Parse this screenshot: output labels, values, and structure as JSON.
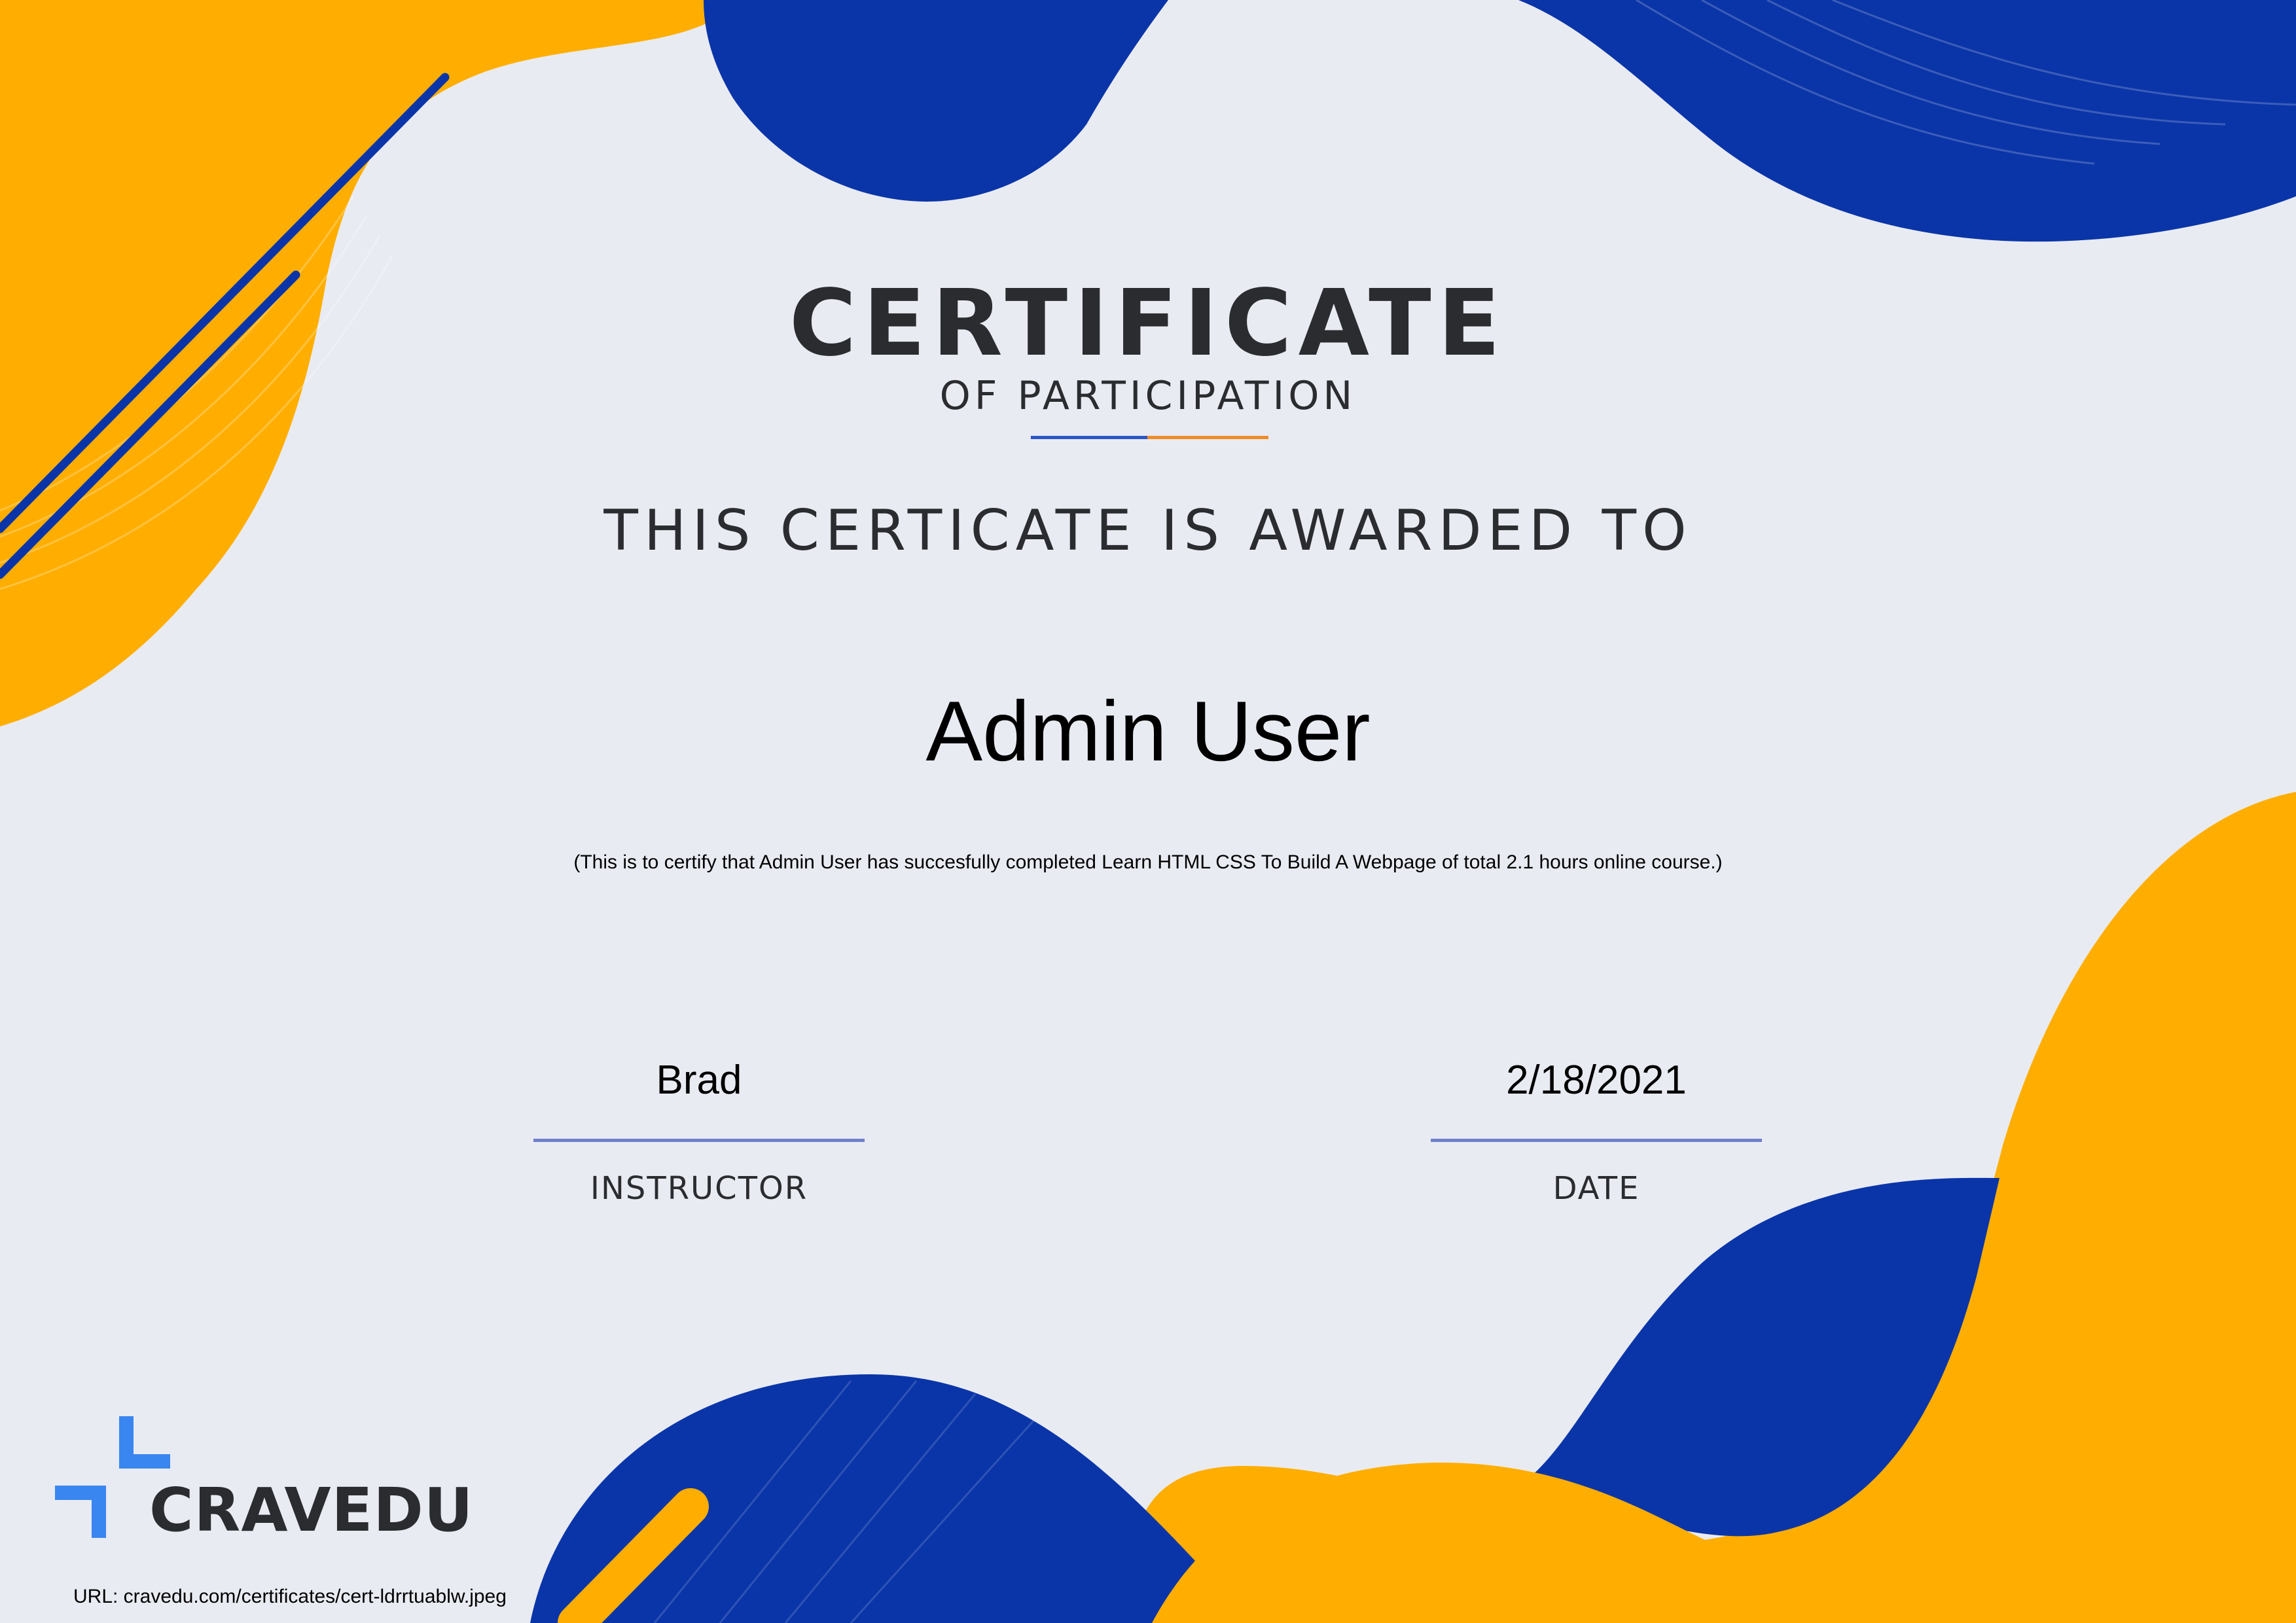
{
  "certificate": {
    "title": "CERTIFICATE",
    "subtitle": "OF PARTICIPATION",
    "awarded_text": "THIS CERTICATE IS AWARDED TO",
    "recipient_name": "Admin User",
    "statement": "(This is to certify that Admin User has succesfully completed Learn HTML CSS To Build A Webpage of total 2.1 hours online course.)"
  },
  "signatures": {
    "instructor": {
      "value": "Brad",
      "label": "INSTRUCTOR"
    },
    "date": {
      "value": "2/18/2021",
      "label": "DATE"
    }
  },
  "footer": {
    "brand_name": "CRAVEDU",
    "url_text": "URL: cravedu.com/certificates/cert-ldrrtuablw.jpeg"
  },
  "colors": {
    "background": "#e9ebf2",
    "accent_blue": "#0a35a8",
    "accent_yellow": "#ffae00",
    "logo_blue": "#3a86f0",
    "text_dark": "#2b2c30",
    "divider_blue": "#2b56c9",
    "divider_orange": "#f08c28"
  },
  "icons": {
    "logo": "cravedu-logo-icon"
  }
}
